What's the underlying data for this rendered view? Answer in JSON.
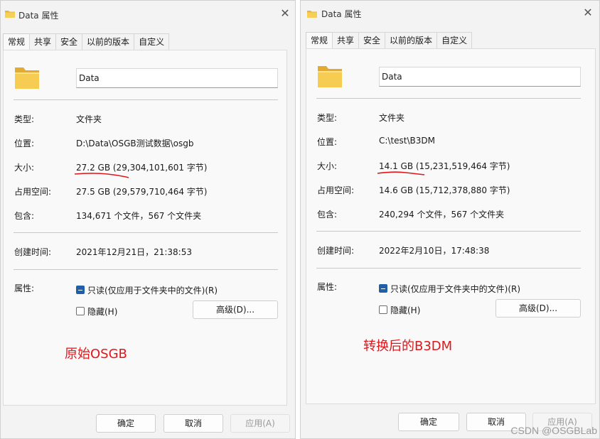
{
  "left": {
    "window_title": "Data 属性",
    "tabs": [
      "常规",
      "共享",
      "安全",
      "以前的版本",
      "自定义"
    ],
    "folder_name": "Data",
    "rows": {
      "type_label": "类型:",
      "type_value": "文件夹",
      "location_label": "位置:",
      "location_value": "D:\\Data\\OSGB测试数据\\osgb",
      "size_label": "大小:",
      "size_value": "27.2 GB (29,304,101,601 字节)",
      "disk_label": "占用空间:",
      "disk_value": "27.5 GB (29,579,710,464 字节)",
      "contains_label": "包含:",
      "contains_value": "134,671 个文件，567 个文件夹",
      "created_label": "创建时间:",
      "created_value": "2021年12月21日，21:38:53",
      "attrs_label": "属性:"
    },
    "readonly_label": "只读(仅应用于文件夹中的文件)(R)",
    "readonly_checked": "partial",
    "hidden_label": "隐藏(H)",
    "hidden_checked": false,
    "advanced_button": "高级(D)...",
    "annotation": "原始OSGB",
    "ok_button": "确定",
    "cancel_button": "取消",
    "apply_button": "应用(A)"
  },
  "right": {
    "window_title": "Data 属性",
    "tabs": [
      "常规",
      "共享",
      "安全",
      "以前的版本",
      "自定义"
    ],
    "folder_name": "Data",
    "rows": {
      "type_label": "类型:",
      "type_value": "文件夹",
      "location_label": "位置:",
      "location_value": "C:\\test\\B3DM",
      "size_label": "大小:",
      "size_value": "14.1 GB (15,231,519,464 字节)",
      "disk_label": "占用空间:",
      "disk_value": "14.6 GB (15,712,378,880 字节)",
      "contains_label": "包含:",
      "contains_value": "240,294 个文件，567 个文件夹",
      "created_label": "创建时间:",
      "created_value": "2022年2月10日，17:48:38",
      "attrs_label": "属性:"
    },
    "readonly_label": "只读(仅应用于文件夹中的文件)(R)",
    "readonly_checked": "partial",
    "hidden_label": "隐藏(H)",
    "hidden_checked": false,
    "advanced_button": "高级(D)...",
    "annotation": "转换后的B3DM",
    "ok_button": "确定",
    "cancel_button": "取消",
    "apply_button": "应用(A)"
  },
  "watermark": "CSDN @OSGBLab",
  "colors": {
    "annotation_red": "#e0161b",
    "folder_yellow": "#f2c744",
    "checkbox_blue": "#1f5fa8",
    "window_bg": "#f3f3f3"
  },
  "icons": {
    "title_icon": "folder-icon",
    "close_icon": "close-icon",
    "big_icon": "folder-icon"
  }
}
